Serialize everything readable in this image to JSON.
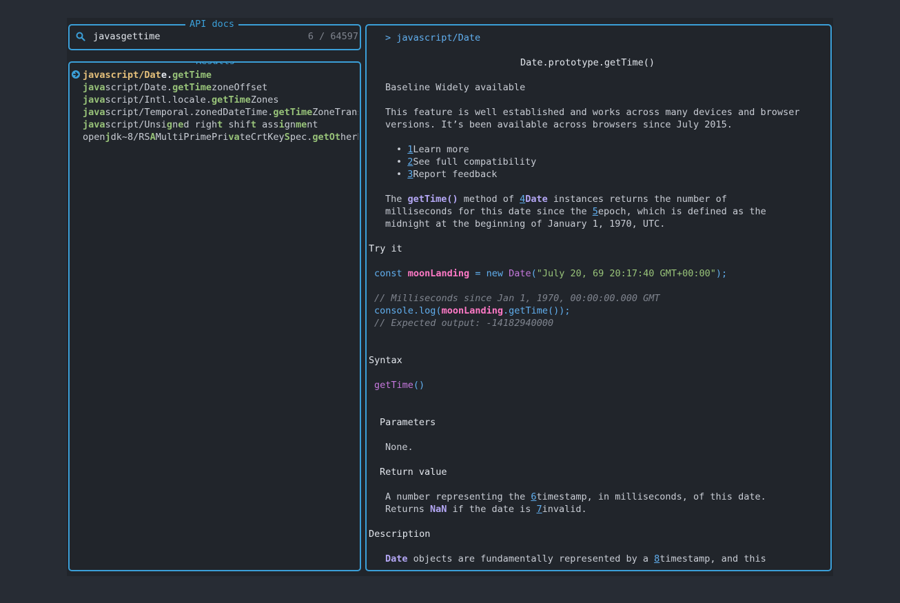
{
  "search": {
    "title": "API docs",
    "query": "javasgettime",
    "count": "6 / 64597"
  },
  "results": {
    "title": "Results",
    "items": [
      [
        [
          "javas",
          "sel"
        ],
        [
          "cript/",
          "sel"
        ],
        [
          "Dat",
          "sel"
        ],
        [
          "e.",
          "sel-rest"
        ],
        [
          "getTime",
          "m"
        ]
      ],
      [
        [
          "java",
          "m"
        ],
        [
          "script/Date.",
          ""
        ],
        [
          "getTime",
          "m"
        ],
        [
          "zoneOffset",
          ""
        ]
      ],
      [
        [
          "java",
          "m"
        ],
        [
          "script/Intl.locale.",
          ""
        ],
        [
          "getTime",
          "m"
        ],
        [
          "Zones",
          ""
        ]
      ],
      [
        [
          "java",
          "m"
        ],
        [
          "script/Temporal.zonedDateTime.",
          ""
        ],
        [
          "getTime",
          "m"
        ],
        [
          "ZoneTransi",
          ""
        ]
      ],
      [
        [
          "java",
          "m"
        ],
        [
          "script/Unsi",
          ""
        ],
        [
          "g",
          "m"
        ],
        [
          "n",
          ""
        ],
        [
          "e",
          "m"
        ],
        [
          "d righ",
          ""
        ],
        [
          "t",
          "m"
        ],
        [
          " shif",
          ""
        ],
        [
          "t",
          "m"
        ],
        [
          " ass",
          ""
        ],
        [
          "i",
          "m"
        ],
        [
          "gn",
          ""
        ],
        [
          "me",
          "m"
        ],
        [
          "nt",
          ""
        ]
      ],
      [
        [
          "open",
          ""
        ],
        [
          "j",
          "m"
        ],
        [
          "dk~8/RS",
          ""
        ],
        [
          "A",
          "m"
        ],
        [
          "MultiPrimePri",
          ""
        ],
        [
          "va",
          "m"
        ],
        [
          "teCrtKey",
          ""
        ],
        [
          "S",
          "m"
        ],
        [
          "pec.",
          ""
        ],
        [
          "get",
          "m"
        ],
        [
          "O",
          "m"
        ],
        [
          "t",
          "m"
        ],
        [
          "herPr",
          ""
        ]
      ]
    ]
  },
  "doc": {
    "breadcrumb": "> javascript/Date",
    "heading": "Date.prototype.getTime()",
    "baseline": "Baseline Widely available",
    "feature_line1": "This feature is well established and works across many devices and browser",
    "feature_line2": "versions. It’s been available across browsers since July 2015.",
    "bullets": [
      {
        "num": "1",
        "text": "Learn more"
      },
      {
        "num": "2",
        "text": "See full compatibility"
      },
      {
        "num": "3",
        "text": "Report feedback"
      }
    ],
    "intro": {
      "a": "The ",
      "method": "getTime()",
      "b": " method of ",
      "n4": "4",
      "date": "Date",
      "c": " instances returns the number of",
      "line2a": "milliseconds for this date since the ",
      "n5": "5",
      "line2b": "epoch, which is defined as the",
      "line3": "midnight at the beginning of January 1, 1970, UTC."
    },
    "try_it": "Try it",
    "code": {
      "const": "const ",
      "var": "moonLanding",
      "eq": " = ",
      "new": "new ",
      "cls": "Date",
      "open": "(",
      "str": "\"July 20, 69 20:17:40 GMT+00:00\"",
      "close": ");",
      "comment1": "// Milliseconds since Jan 1, 1970, 00:00:00.000 GMT",
      "console": "console",
      "dot": ".",
      "log": "log",
      "lp": "(",
      "var2": "moonLanding",
      "dot2": ".",
      "gettime": "getTime",
      "tail": "());",
      "comment2": "// Expected output: -14182940000"
    },
    "syntax": "Syntax",
    "syntax_fn": "getTime",
    "syntax_paren": "()",
    "parameters": "Parameters",
    "none": "None.",
    "return_value": "Return value",
    "ret": {
      "a": "A number representing the ",
      "n6": "6",
      "b": "timestamp, in milliseconds, of this date.",
      "c": "Returns ",
      "nan": "NaN",
      "d": " if the date is ",
      "n7": "7",
      "e": "invalid."
    },
    "description": "Description",
    "desc": {
      "date": "Date",
      "a": " objects are fundamentally represented by a ",
      "n8": "8",
      "b": "timestamp, and this"
    }
  },
  "colors": {
    "border": "#3b9fd8",
    "match": "#98c379",
    "selected": "#e5c07b",
    "link": "#61afef"
  }
}
